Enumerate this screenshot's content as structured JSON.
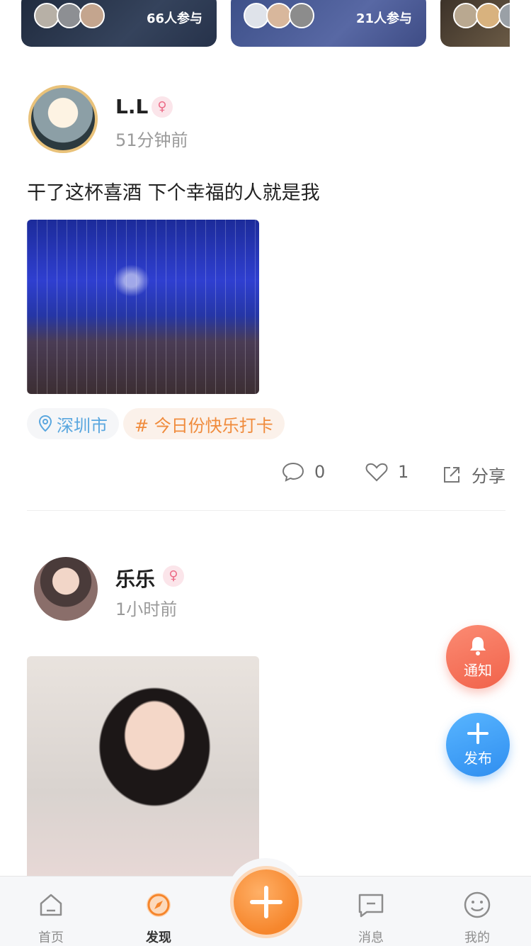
{
  "topics": [
    {
      "count_text": "66人参与"
    },
    {
      "count_text": "21人参与"
    },
    {
      "count_text": ""
    }
  ],
  "posts": [
    {
      "user_name": "L.L",
      "time": "51分钟前",
      "text": "干了这杯喜酒 下个幸福的人就是我",
      "location": "深圳市",
      "topic": "# 今日份快乐打卡",
      "comments": "0",
      "likes": "1",
      "share_label": "分享"
    },
    {
      "user_name": "乐乐",
      "time": "1小时前"
    }
  ],
  "fab": {
    "notify_label": "通知",
    "publish_label": "发布"
  },
  "tabbar": {
    "items": [
      {
        "label": "首页"
      },
      {
        "label": "发现"
      },
      {
        "label": "消息"
      },
      {
        "label": "我的"
      }
    ]
  },
  "colors": {
    "accent_orange": "#f6862c",
    "accent_blue": "#2f8ef0",
    "location_tag": "#5aa7df",
    "topic_tag": "#f08b3c",
    "female_badge": "#ec6b87"
  }
}
